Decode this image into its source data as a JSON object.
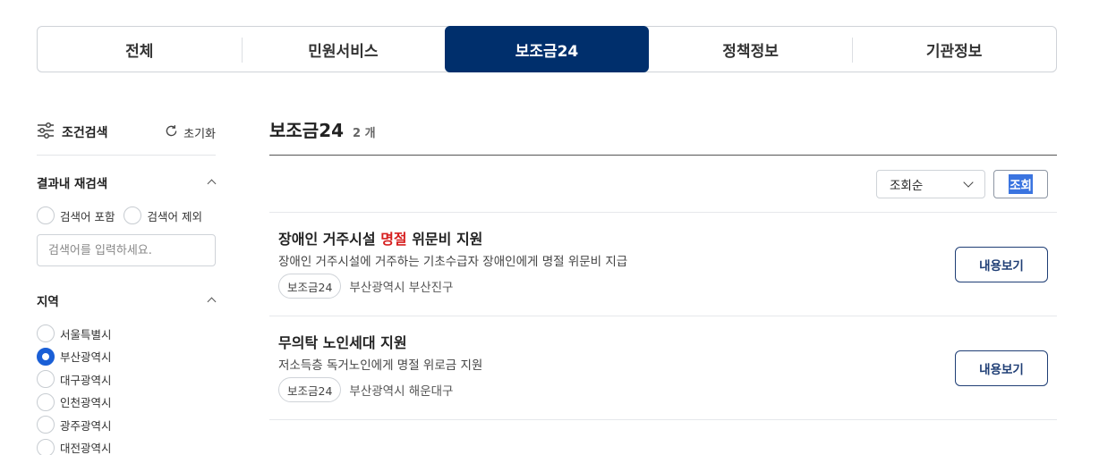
{
  "tabs": [
    {
      "label": "전체"
    },
    {
      "label": "민원서비스"
    },
    {
      "label": "보조금24",
      "active": true
    },
    {
      "label": "정책정보"
    },
    {
      "label": "기관정보"
    }
  ],
  "sidebar": {
    "title": "조건검색",
    "title_icon": "filter-sliders-icon",
    "reset_label": "초기화",
    "reset_icon": "refresh-icon",
    "refine": {
      "title": "결과내 재검색",
      "include_label": "검색어 포함",
      "exclude_label": "검색어 제외",
      "placeholder": "검색어를 입력하세요."
    },
    "region": {
      "title": "지역",
      "options": [
        {
          "label": "서울특별시",
          "checked": false
        },
        {
          "label": "부산광역시",
          "checked": true
        },
        {
          "label": "대구광역시",
          "checked": false
        },
        {
          "label": "인천광역시",
          "checked": false
        },
        {
          "label": "광주광역시",
          "checked": false
        },
        {
          "label": "대전광역시",
          "checked": false
        }
      ]
    }
  },
  "main": {
    "title": "보조금24",
    "count": "2 개",
    "sort": {
      "selected": "조회순"
    },
    "query_button": "조회",
    "results": [
      {
        "title_pre": "장애인 거주시설 ",
        "title_highlight": "명절",
        "title_post": " 위문비 지원",
        "desc": "장애인 거주시설에 거주하는 기초수급자 장애인에게 명절 위문비 지급",
        "tag": "보조금24",
        "location": "부산광역시 부산진구",
        "button": "내용보기"
      },
      {
        "title_pre": "무의탁 노인세대 지원",
        "title_highlight": "",
        "title_post": "",
        "desc": "저소득층 독거노인에게 명절 위로금 지원",
        "tag": "보조금24",
        "location": "부산광역시 해운대구",
        "button": "내용보기"
      }
    ]
  },
  "colors": {
    "active_tab_bg": "#002f6c",
    "highlight": "#d61f1f",
    "radio_checked": "#1a5fd6",
    "button_border": "#1f3e75"
  }
}
